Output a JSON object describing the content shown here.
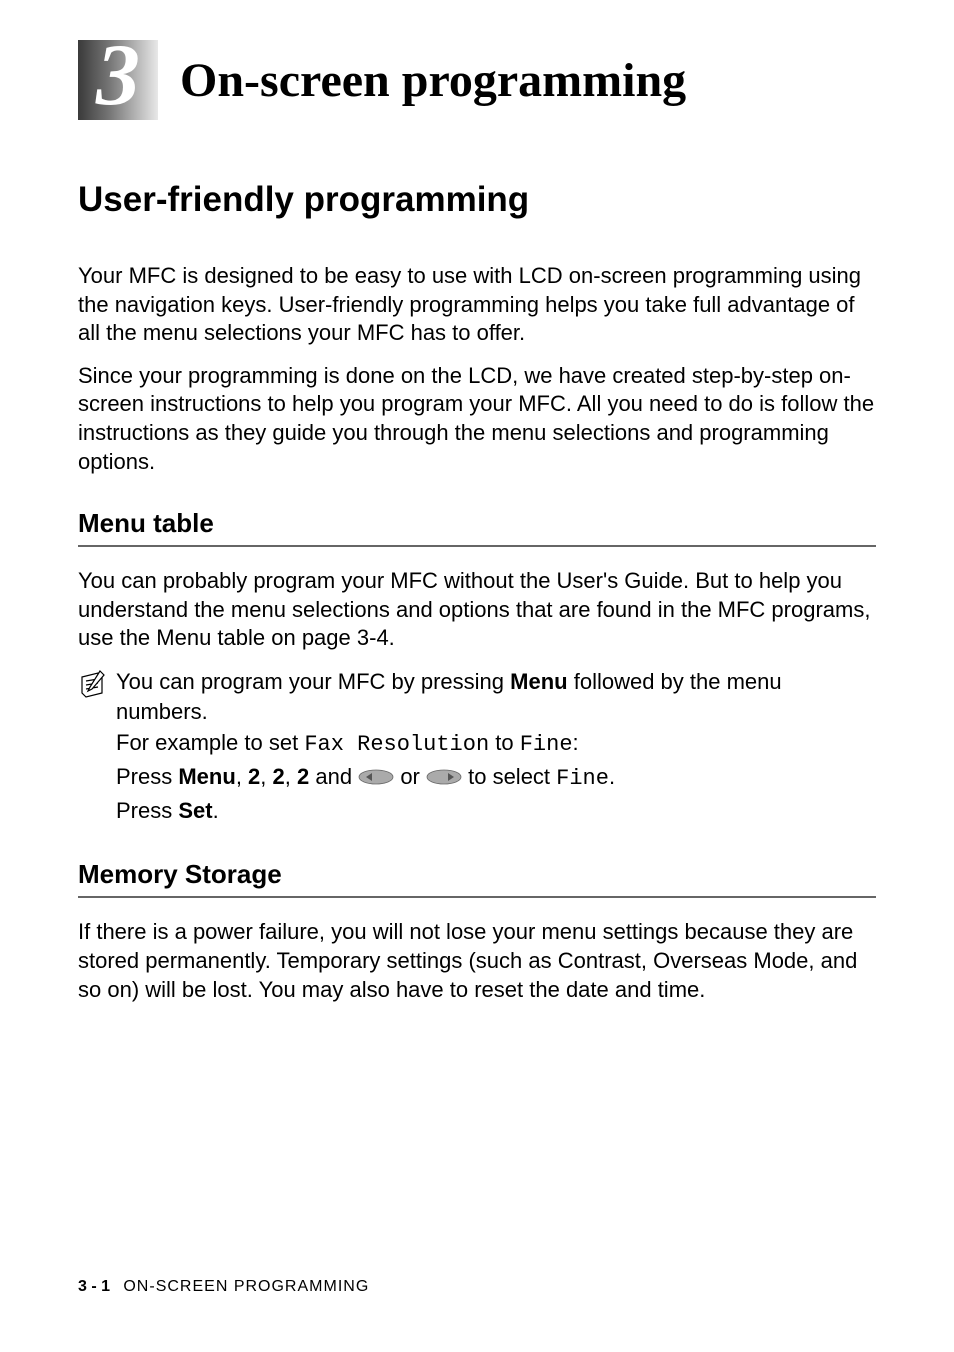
{
  "chapter": {
    "number": "3",
    "title": "On-screen programming"
  },
  "section": {
    "title": "User-friendly programming",
    "para1": "Your MFC is designed to be easy to use with LCD on-screen programming using the navigation keys. User-friendly programming helps you take full advantage of all the menu selections your MFC has to offer.",
    "para2": "Since your programming is done on the LCD, we have created step-by-step on-screen instructions to help you program your MFC. All you need to do is follow the instructions as they guide you through the menu selections and programming options."
  },
  "menu_table": {
    "heading": "Menu table",
    "body": "You can probably program your MFC without the User's Guide. But to help you understand the menu selections and options that are found in the MFC programs, use the Menu table on page 3-4.",
    "note": {
      "line1_prefix": "You can program your MFC by pressing ",
      "line1_menu": "Menu",
      "line1_suffix": " followed by the menu numbers.",
      "line2_prefix": "For example to set ",
      "line2_mono1": "Fax Resolution",
      "line2_mid": " to ",
      "line2_mono2": "Fine",
      "line2_suffix": ":",
      "line3_prefix": "Press ",
      "line3_menu": "Menu",
      "line3_comma1": ", ",
      "line3_num1": "2",
      "line3_comma2": ", ",
      "line3_num2": "2",
      "line3_comma3": ", ",
      "line3_num3": "2",
      "line3_and": " and ",
      "line3_or": " or ",
      "line3_select": " to select ",
      "line3_fine": "Fine",
      "line3_period": ".",
      "line4_prefix": "Press ",
      "line4_set": "Set",
      "line4_suffix": "."
    }
  },
  "memory_storage": {
    "heading": "Memory Storage",
    "body": "If there is a power failure, you will not lose your menu settings because they are stored permanently. Temporary settings (such as Contrast, Overseas Mode, and so on) will be lost. You may also have to reset the date and time."
  },
  "footer": {
    "page": "3 - 1",
    "label": "ON-SCREEN PROGRAMMING"
  }
}
